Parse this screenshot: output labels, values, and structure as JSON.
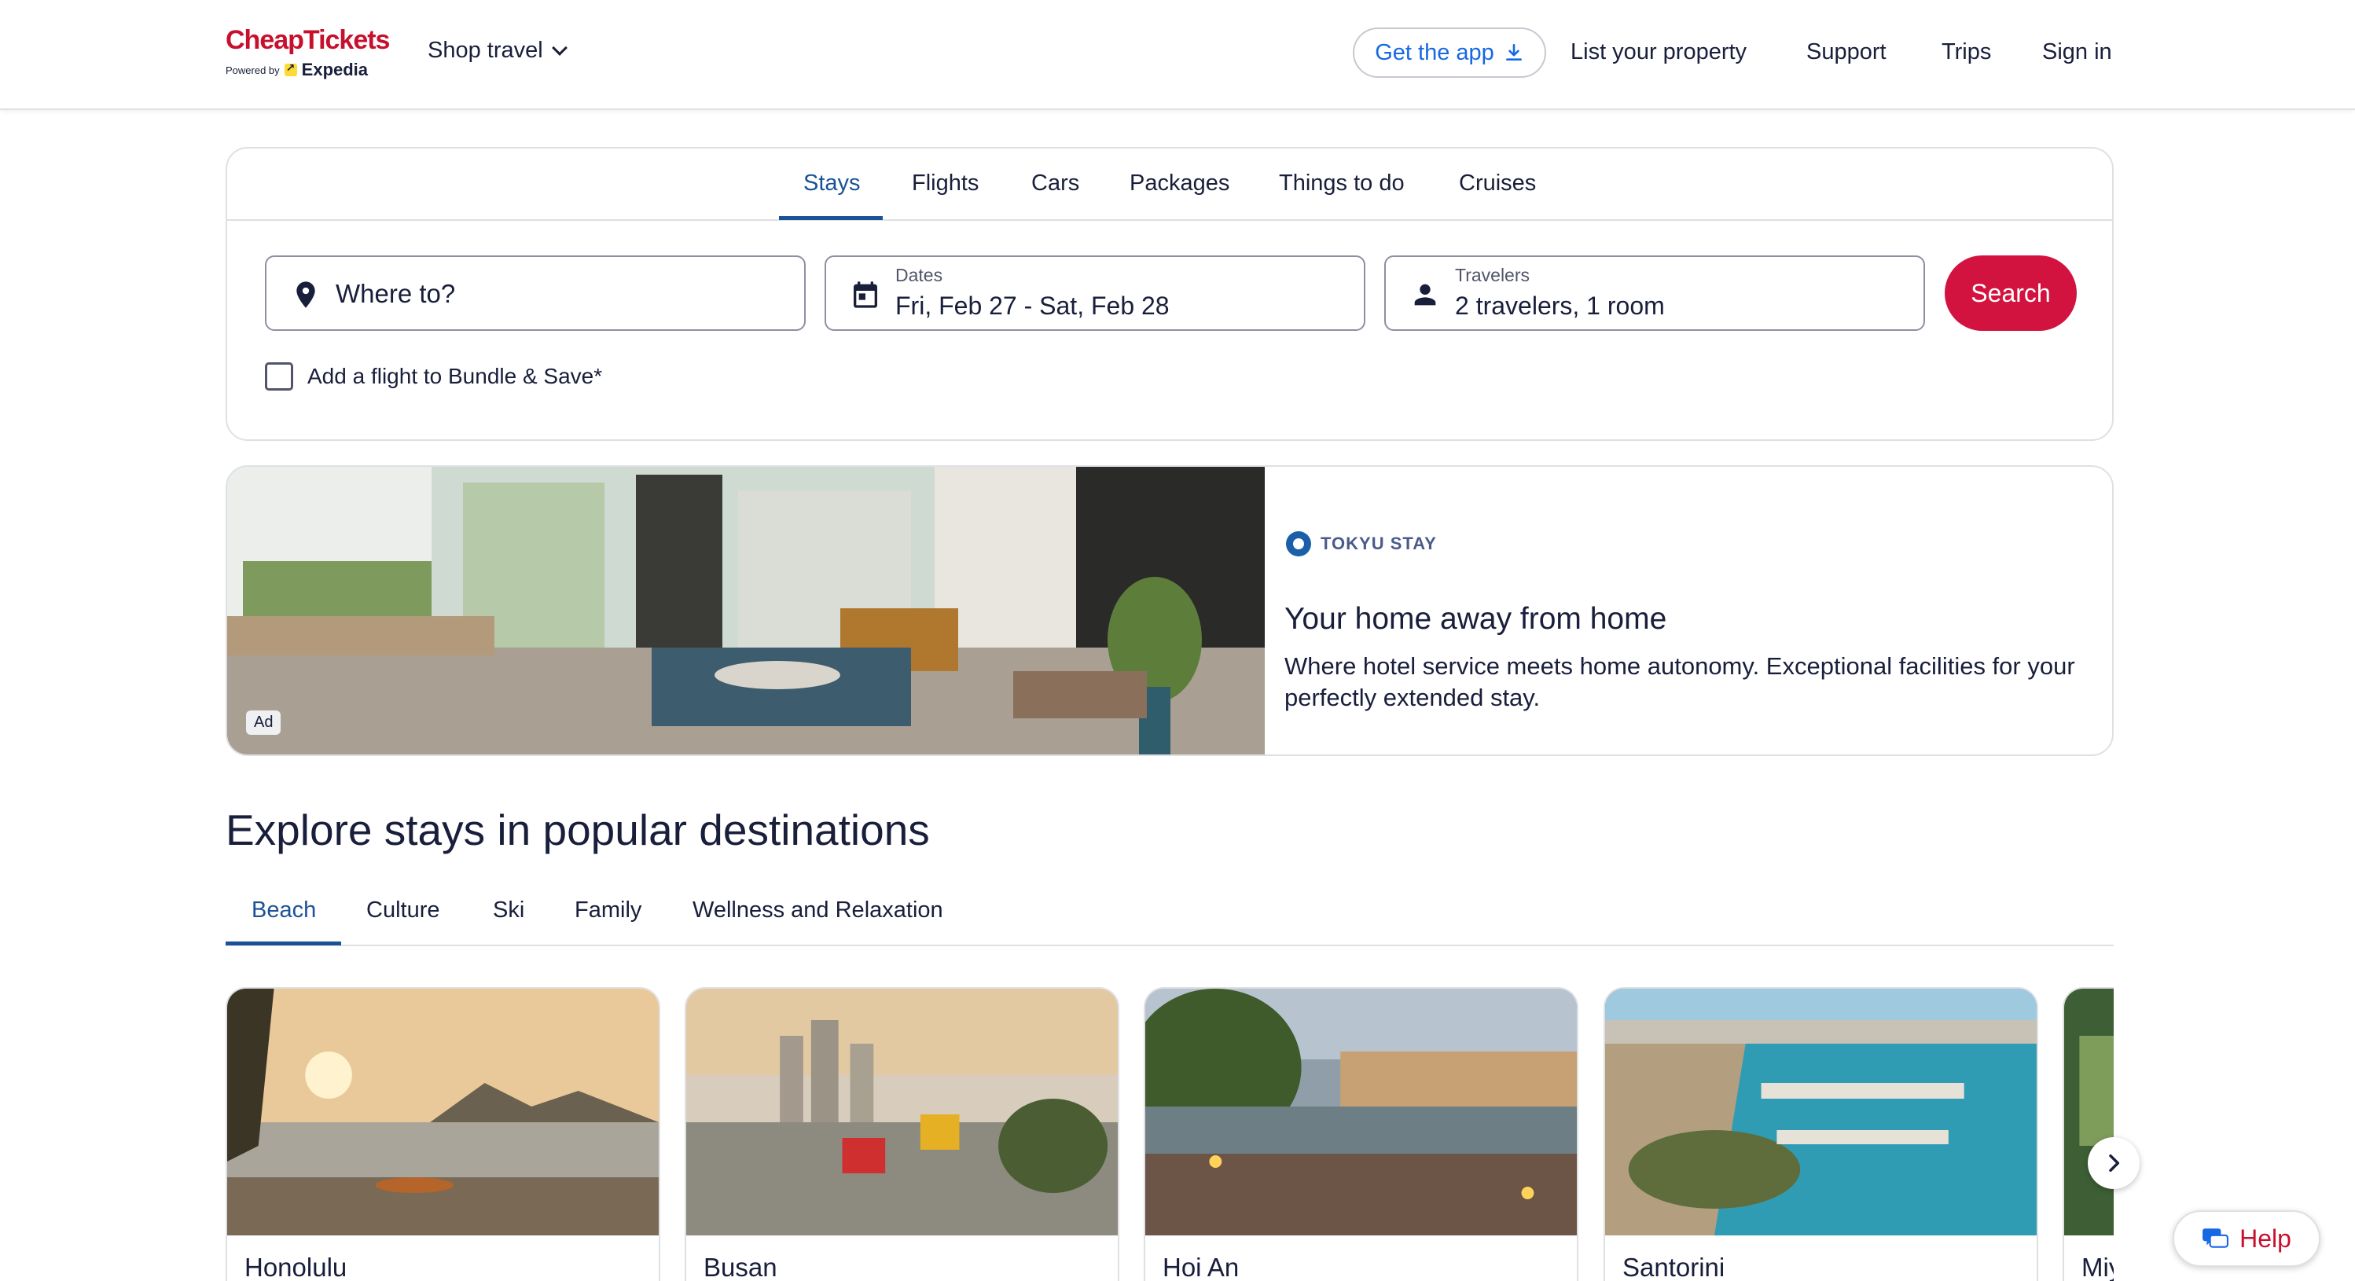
{
  "header": {
    "brand": "CheapTickets",
    "powered_by": "Powered by",
    "partner": "Expedia",
    "shop_travel": "Shop travel",
    "get_app": "Get the app",
    "links": [
      "List your property",
      "Support",
      "Trips",
      "Sign in"
    ]
  },
  "search": {
    "tabs": [
      "Stays",
      "Flights",
      "Cars",
      "Packages",
      "Things to do",
      "Cruises"
    ],
    "active_tab": "Stays",
    "destination_placeholder": "Where to?",
    "dates_label": "Dates",
    "dates_value": "Fri, Feb 27 - Sat, Feb 28",
    "travelers_label": "Travelers",
    "travelers_value": "2 travelers, 1 room",
    "search_button": "Search",
    "bundle_label": "Add a flight to Bundle & Save*"
  },
  "ad": {
    "badge": "Ad",
    "brand": "TOKYU STAY",
    "title": "Your home away from home",
    "description": "Where hotel service meets home autonomy. Exceptional facilities for your perfectly extended stay."
  },
  "explore": {
    "title": "Explore stays in popular destinations",
    "categories": [
      "Beach",
      "Culture",
      "Ski",
      "Family",
      "Wellness and Relaxation"
    ],
    "active_category": "Beach",
    "destinations": [
      "Honolulu",
      "Busan",
      "Hoi An",
      "Santorini",
      "Miy"
    ]
  },
  "help": {
    "label": "Help"
  },
  "colors": {
    "brand_red": "#c8102e",
    "search_red": "#d3133f",
    "active_blue": "#1a5296",
    "link_blue": "#1668e3"
  }
}
